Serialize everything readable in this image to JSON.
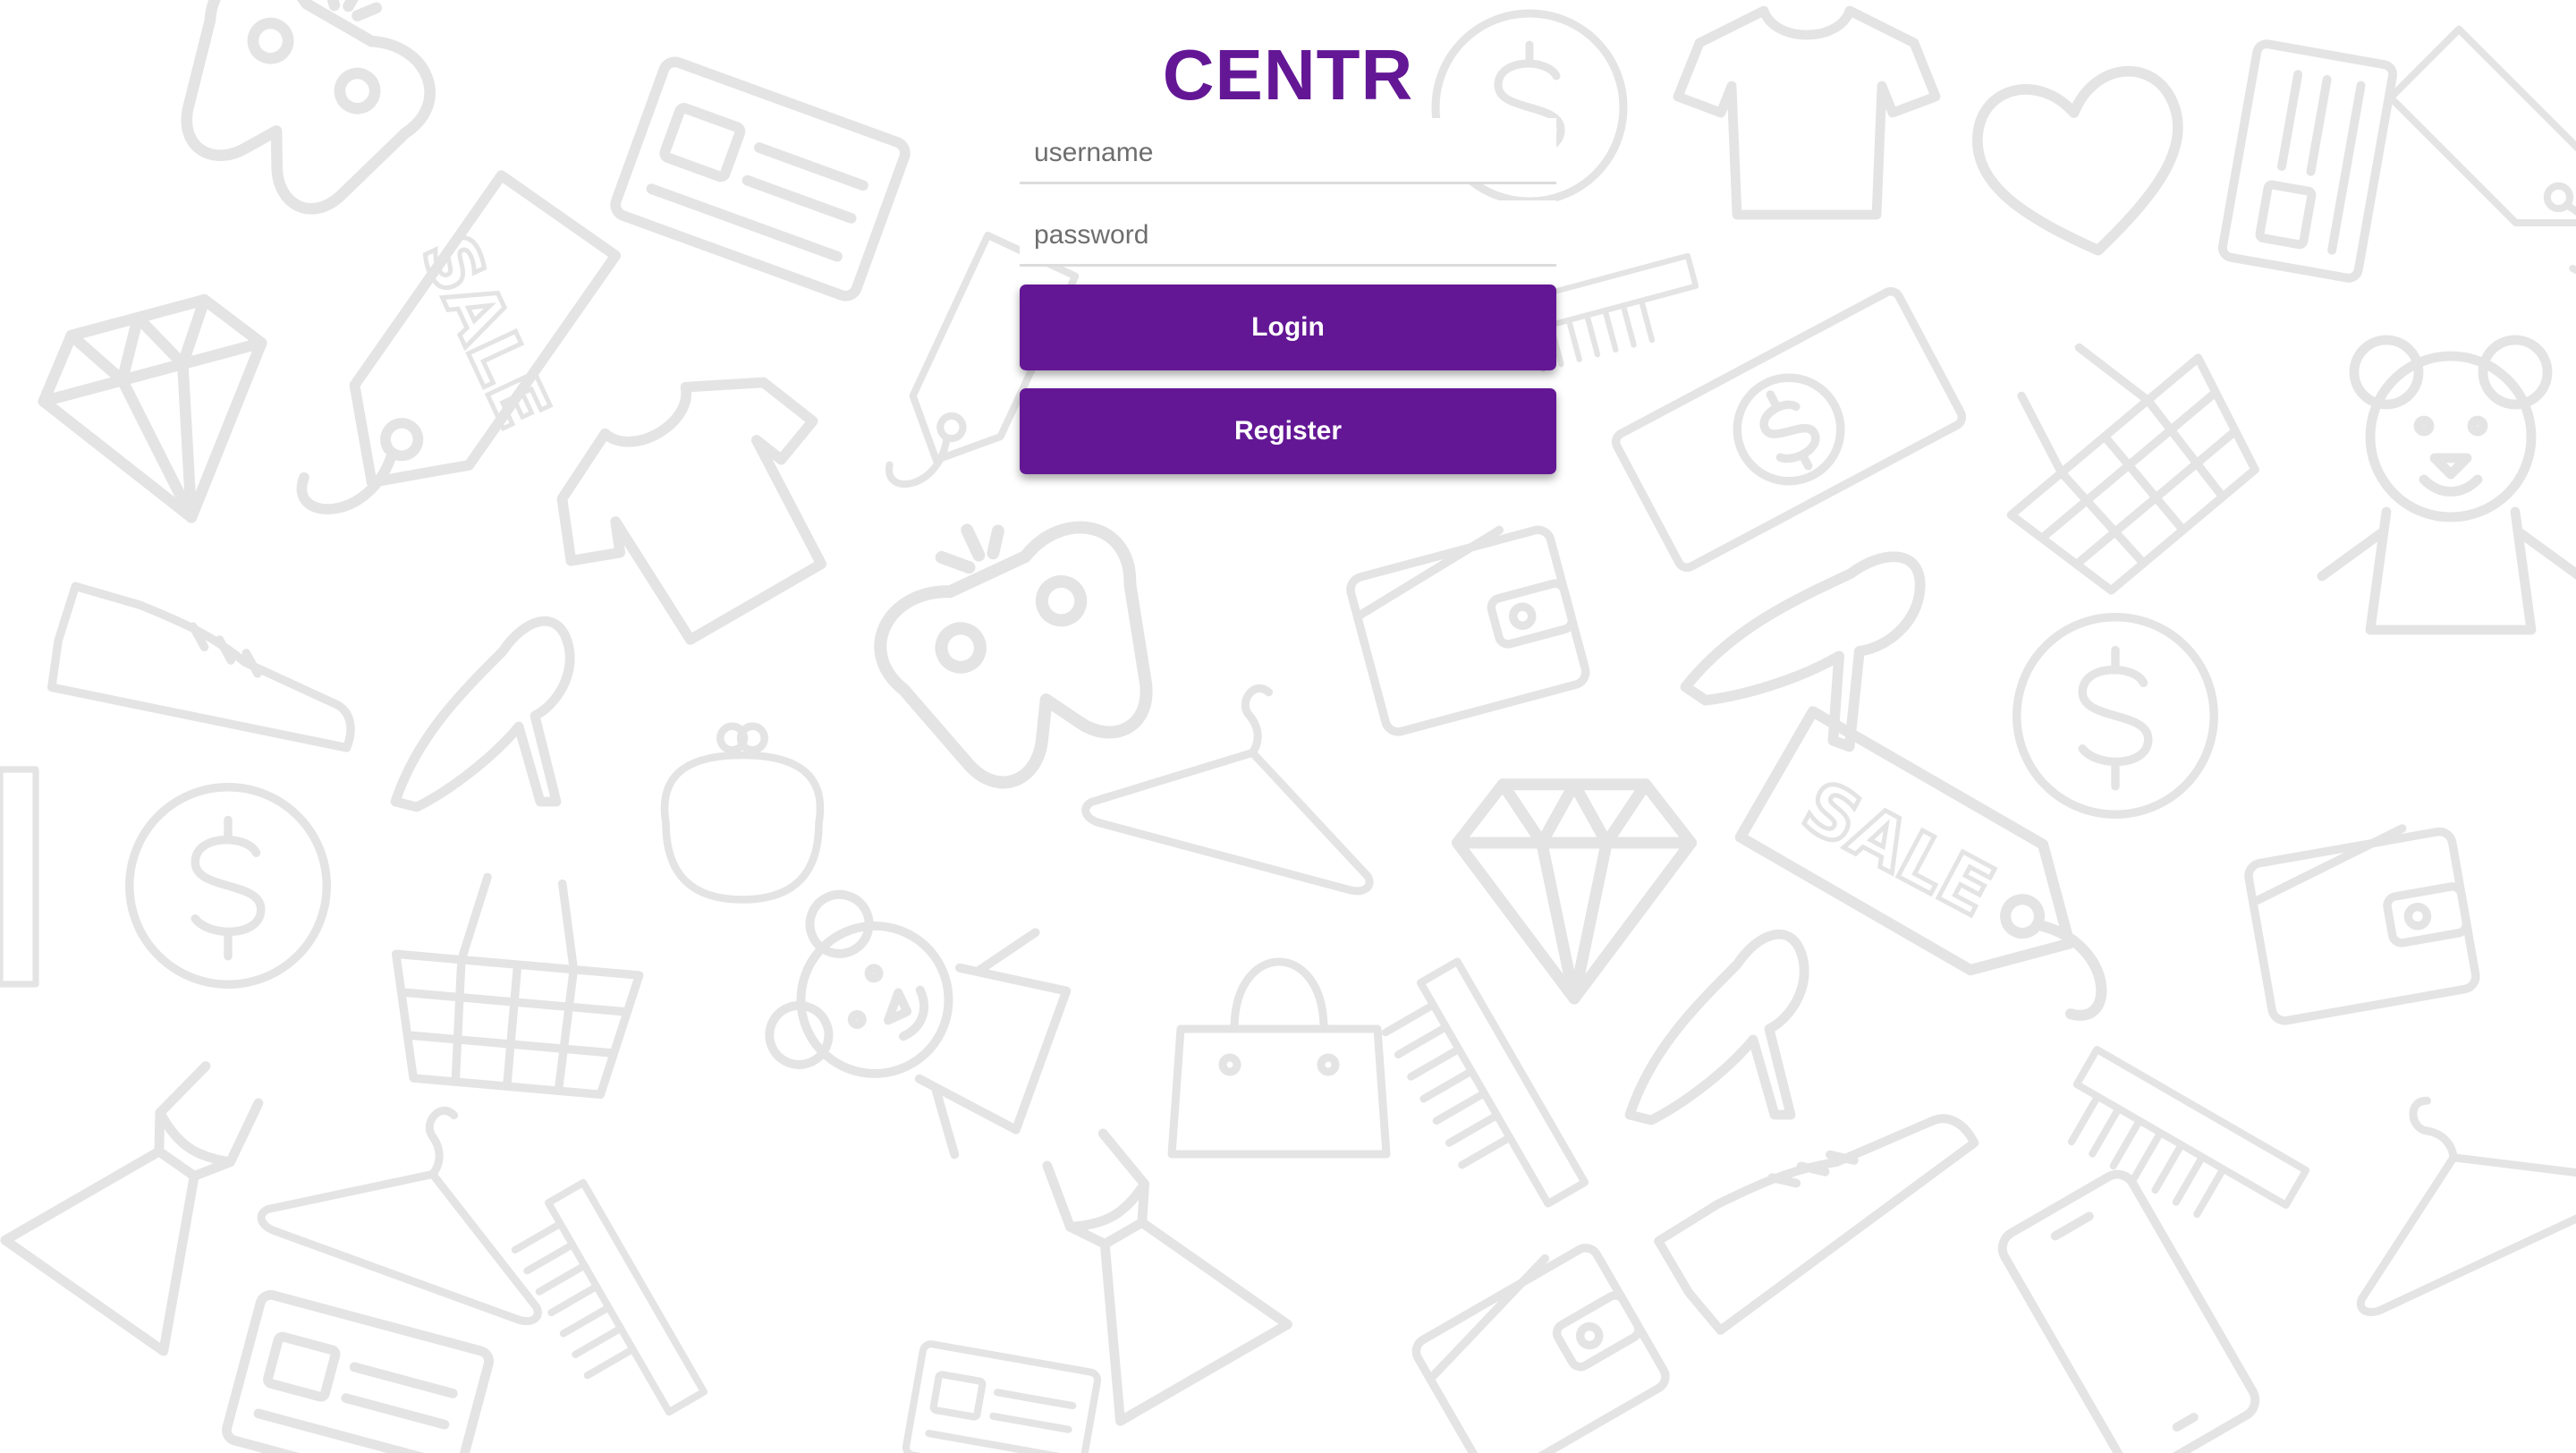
{
  "app": {
    "brand": "CENTR"
  },
  "form": {
    "username_placeholder": "username",
    "username_value": "",
    "password_placeholder": "password",
    "password_value": "",
    "login_label": "Login",
    "register_label": "Register"
  },
  "background": {
    "sale_tag_text": "SALE",
    "icons": [
      "gamepad-icon",
      "tshirt-icon",
      "heart-icon",
      "credit-card-icon",
      "sale-tag-icon",
      "diamond-icon",
      "dollar-coin-icon",
      "money-bill-icon",
      "shopping-basket-icon",
      "teddy-bear-icon",
      "sneaker-icon",
      "high-heel-icon",
      "wallet-icon",
      "coin-purse-icon",
      "hanger-icon",
      "handbag-icon",
      "comb-icon",
      "dress-icon",
      "smartphone-icon"
    ]
  },
  "colors": {
    "brand": "#631795",
    "button_bg": "#631795",
    "button_text": "#ffffff",
    "pattern_stroke": "#e4e4e4",
    "background": "#ffffff"
  }
}
